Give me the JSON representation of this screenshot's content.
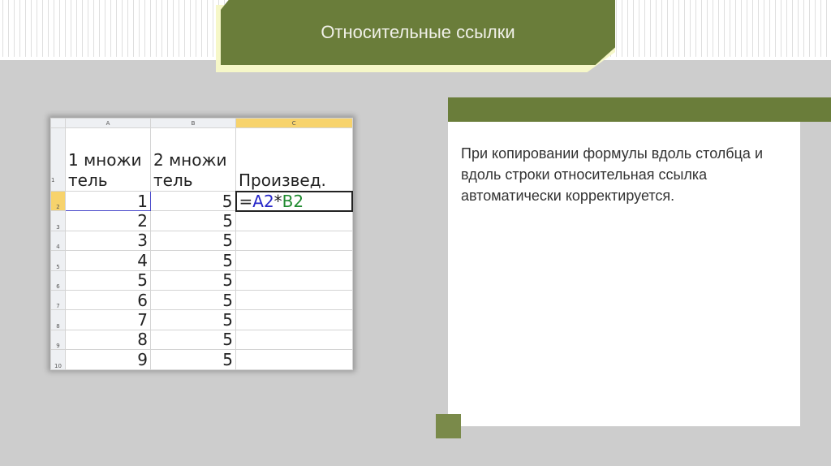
{
  "title": "Относительные ссылки",
  "description": "При копировании формулы вдоль столбца и вдоль строки относительная ссылка автоматически корректируется.",
  "sheet": {
    "columns": [
      "A",
      "B",
      "C"
    ],
    "header": {
      "a": "1 множи тель",
      "b": "2 множи тель",
      "c": "Произвед."
    },
    "formula": {
      "eq": "=",
      "ref_a": "A2",
      "op": "*",
      "ref_b": "B2"
    },
    "rows": [
      {
        "n": "2",
        "a": "1",
        "b": "5"
      },
      {
        "n": "3",
        "a": "2",
        "b": "5"
      },
      {
        "n": "4",
        "a": "3",
        "b": "5"
      },
      {
        "n": "5",
        "a": "4",
        "b": "5"
      },
      {
        "n": "6",
        "a": "5",
        "b": "5"
      },
      {
        "n": "7",
        "a": "6",
        "b": "5"
      },
      {
        "n": "8",
        "a": "7",
        "b": "5"
      },
      {
        "n": "9",
        "a": "8",
        "b": "5"
      },
      {
        "n": "10",
        "a": "9",
        "b": "5"
      }
    ],
    "row1": "1"
  }
}
